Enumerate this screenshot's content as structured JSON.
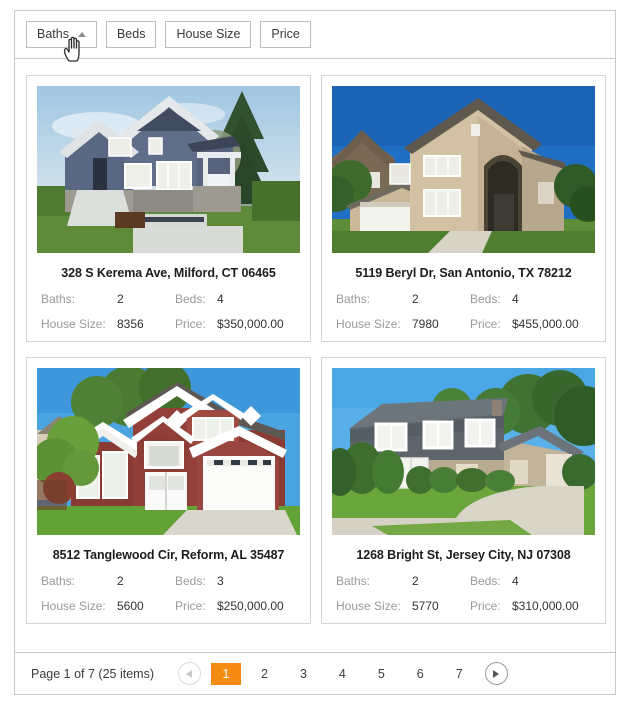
{
  "toolbar": {
    "sort_buttons": [
      {
        "label": "Baths",
        "sort": "asc",
        "active": true
      },
      {
        "label": "Beds",
        "sort": "none",
        "active": false
      },
      {
        "label": "House Size",
        "sort": "none",
        "active": false
      },
      {
        "label": "Price",
        "sort": "none",
        "active": false
      }
    ]
  },
  "labels": {
    "baths": "Baths:",
    "beds": "Beds:",
    "house_size": "House Size:",
    "price": "Price:"
  },
  "listings": [
    {
      "address": "328 S Kerema Ave, Milford, CT 06465",
      "baths": "2",
      "beds": "4",
      "house_size": "8356",
      "price": "$350,000.00",
      "photo": "blue-craftsman-house"
    },
    {
      "address": "5119 Beryl Dr, San Antonio, TX 78212",
      "baths": "2",
      "beds": "4",
      "house_size": "7980",
      "price": "$455,000.00",
      "photo": "tan-brick-two-story-house"
    },
    {
      "address": "8512 Tanglewood Cir, Reform, AL 35487",
      "baths": "2",
      "beds": "3",
      "house_size": "5600",
      "price": "$250,000.00",
      "photo": "red-brick-house-white-trim"
    },
    {
      "address": "1268 Bright St, Jersey City, NJ 07308",
      "baths": "2",
      "beds": "4",
      "house_size": "5770",
      "price": "$310,000.00",
      "photo": "grey-mansard-roof-house"
    }
  ],
  "pager": {
    "info": "Page 1 of 7 (25 items)",
    "prev_icon": "chevron-left-icon",
    "next_icon": "chevron-right-icon",
    "pages": [
      "1",
      "2",
      "3",
      "4",
      "5",
      "6",
      "7"
    ],
    "current_page": "1",
    "accent_color": "#f58b12"
  }
}
